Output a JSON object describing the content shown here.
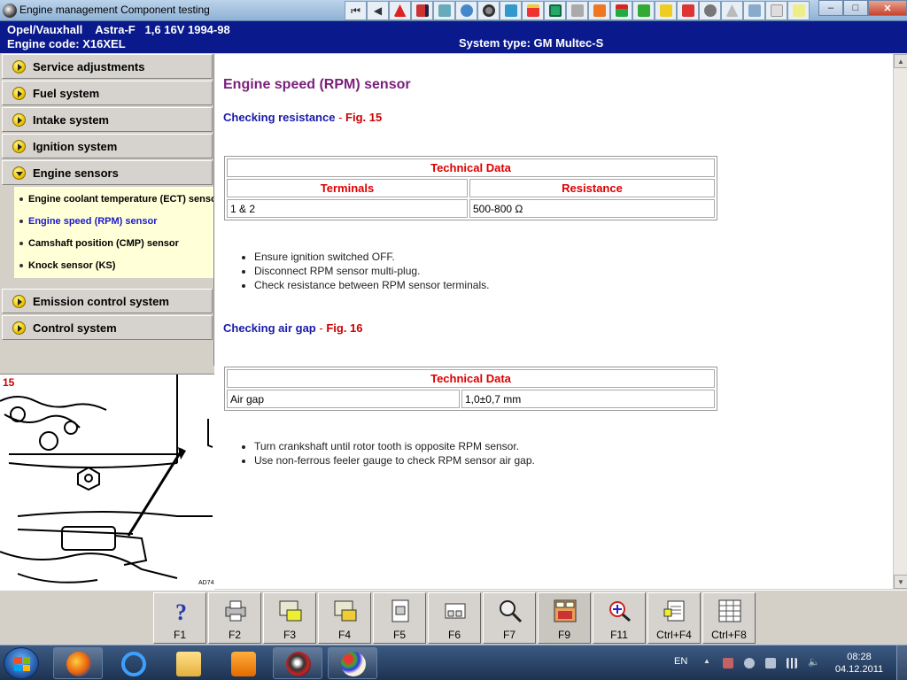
{
  "window": {
    "title": "Engine management Component testing",
    "controls": {
      "minimize": "–",
      "maximize": "□",
      "close": "✕"
    }
  },
  "toolbar_icons": [
    "first-icon",
    "prev-icon",
    "warning-icon",
    "book-icon",
    "diagram-icon",
    "gear-icon",
    "tire-icon",
    "wrench-icon",
    "filter-icon",
    "door-icon",
    "tools-icon",
    "tag-icon",
    "steps-icon",
    "car-icon",
    "battery-icon",
    "lock-icon",
    "fan-icon",
    "road-icon",
    "ac-icon",
    "check-icon",
    "page-icon"
  ],
  "header": {
    "vehicle": "Opel/Vauxhall    Astra-F   1,6 16V 1994-98",
    "engine_code": "Engine code: X16XEL",
    "system_type": "System type: GM Multec-S"
  },
  "nav": {
    "items": [
      {
        "label": "Service adjustments",
        "expanded": false
      },
      {
        "label": "Fuel system",
        "expanded": false
      },
      {
        "label": "Intake system",
        "expanded": false
      },
      {
        "label": "Ignition system",
        "expanded": false
      },
      {
        "label": "Engine sensors",
        "expanded": true
      },
      {
        "label": "Emission control system",
        "expanded": false
      },
      {
        "label": "Control system",
        "expanded": false
      }
    ],
    "subitems": [
      {
        "label": "Engine coolant temperature (ECT) sensor",
        "active": false
      },
      {
        "label": "Engine speed (RPM) sensor",
        "active": true
      },
      {
        "label": "Camshaft position (CMP) sensor",
        "active": false
      },
      {
        "label": "Knock sensor (KS)",
        "active": false
      }
    ]
  },
  "figure": {
    "number": "15",
    "code": "AD74"
  },
  "content": {
    "title": "Engine speed (RPM) sensor",
    "section1": {
      "heading": "Checking resistance",
      "sep": " - ",
      "fig": "Fig. 15"
    },
    "table1": {
      "title": "Technical Data",
      "col1": "Terminals",
      "col2": "Resistance",
      "rows": [
        {
          "terminals": "1 & 2",
          "resistance": "500-800 Ω"
        }
      ]
    },
    "bullets1": [
      "Ensure ignition switched OFF.",
      "Disconnect RPM sensor multi-plug.",
      "Check resistance between RPM sensor terminals."
    ],
    "section2": {
      "heading": "Checking air gap",
      "sep": " - ",
      "fig": "Fig. 16"
    },
    "table2": {
      "title": "Technical Data",
      "label": "Air gap",
      "value": "1,0±0,7 mm"
    },
    "bullets2": [
      "Turn crankshaft until rotor tooth is opposite RPM sensor.",
      "Use non-ferrous feeler gauge to check RPM sensor air gap."
    ]
  },
  "function_keys": [
    {
      "label": "F1",
      "icon": "help-icon"
    },
    {
      "label": "F2",
      "icon": "printer-icon"
    },
    {
      "label": "F3",
      "icon": "document-car-icon"
    },
    {
      "label": "F4",
      "icon": "document-hand-icon"
    },
    {
      "label": "F5",
      "icon": "component-icon"
    },
    {
      "label": "F6",
      "icon": "connector-icon"
    },
    {
      "label": "F7",
      "icon": "magnifier-icon"
    },
    {
      "label": "F9",
      "icon": "fuse-box-icon"
    },
    {
      "label": "F11",
      "icon": "diagnose-icon"
    },
    {
      "label": "Ctrl+F4",
      "icon": "notes-icon"
    },
    {
      "label": "Ctrl+F8",
      "icon": "table-icon"
    }
  ],
  "taskbar": {
    "apps": [
      "firefox-icon",
      "ie-icon",
      "explorer-icon",
      "media-player-icon",
      "autodata-icon",
      "paint-icon"
    ],
    "language": "EN",
    "time": "08:28",
    "date": "04.12.2011"
  }
}
